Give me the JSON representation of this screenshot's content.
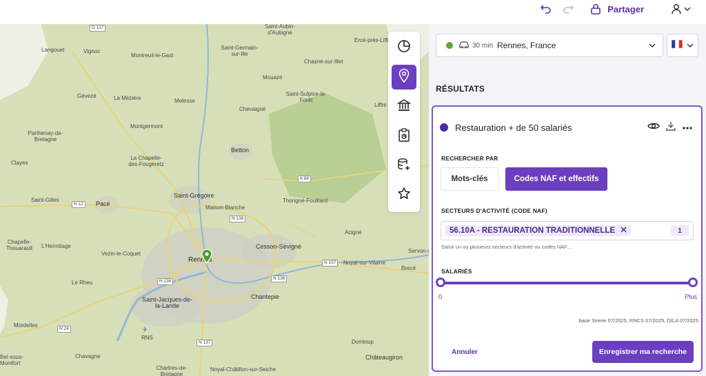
{
  "topbar": {
    "share_label": "Partager",
    "icons": [
      "undo-icon",
      "redo-icon",
      "lock-icon",
      "user-icon",
      "chevron-down-icon"
    ]
  },
  "map": {
    "places": [
      {
        "name": "Langouet",
        "cls": ""
      },
      {
        "name": "Vignoc",
        "cls": ""
      },
      {
        "name": "Montreuil-le-Gast",
        "cls": ""
      },
      {
        "name": "Saint-Germain-sur-Ille",
        "cls": ""
      },
      {
        "name": "Saint-Aubin-d'Aubigné",
        "cls": ""
      },
      {
        "name": "Chasné-sur-Illet",
        "cls": ""
      },
      {
        "name": "Ercé-près-Liffré",
        "cls": ""
      },
      {
        "name": "Gévezé",
        "cls": ""
      },
      {
        "name": "La Mézière",
        "cls": ""
      },
      {
        "name": "Melesse",
        "cls": ""
      },
      {
        "name": "Mouazé",
        "cls": ""
      },
      {
        "name": "Saint-Sulpice-la-Forêt",
        "cls": ""
      },
      {
        "name": "Chevaigné",
        "cls": ""
      },
      {
        "name": "Liffré",
        "cls": ""
      },
      {
        "name": "Parthenay-de-Bretagne",
        "cls": ""
      },
      {
        "name": "Montgermont",
        "cls": ""
      },
      {
        "name": "Betton",
        "cls": "mid"
      },
      {
        "name": "Clayes",
        "cls": ""
      },
      {
        "name": "La Chapelle-des-Fougeretz",
        "cls": ""
      },
      {
        "name": "Saint-Grégoire",
        "cls": "mid"
      },
      {
        "name": "Thorigné-Fouillard",
        "cls": ""
      },
      {
        "name": "Saint-Gilles",
        "cls": ""
      },
      {
        "name": "Pacé",
        "cls": "mid"
      },
      {
        "name": "Maison-Blanche",
        "cls": ""
      },
      {
        "name": "Acigné",
        "cls": ""
      },
      {
        "name": "Chapelle-Thouarault",
        "cls": ""
      },
      {
        "name": "L'Hermitage",
        "cls": ""
      },
      {
        "name": "Cesson-Sévigné",
        "cls": "mid"
      },
      {
        "name": "Vezin-le-Coquet",
        "cls": ""
      },
      {
        "name": "Rennes",
        "cls": "big"
      },
      {
        "name": "Servon-sur-Vilaine",
        "cls": ""
      },
      {
        "name": "Noyal-sur-Vilaine",
        "cls": ""
      },
      {
        "name": "Brecé",
        "cls": ""
      },
      {
        "name": "Le Rheu",
        "cls": ""
      },
      {
        "name": "Saint-Jacques-de-la-Lande",
        "cls": "mid"
      },
      {
        "name": "Chantepie",
        "cls": "mid"
      },
      {
        "name": "Mordelles",
        "cls": ""
      },
      {
        "name": "RNS",
        "cls": ""
      },
      {
        "name": "Domloup",
        "cls": ""
      },
      {
        "name": "Chavagne",
        "cls": ""
      },
      {
        "name": "Châteaugiron",
        "cls": "mid"
      },
      {
        "name": "Noyal-Châtillon-sur-Seiche",
        "cls": ""
      },
      {
        "name": "Chartres-de-Bretagne",
        "cls": ""
      },
      {
        "name": "Bel-sous-Montfort",
        "cls": ""
      }
    ],
    "roads": [
      "D 137",
      "A 84",
      "N 12",
      "N 136",
      "N 136",
      "N 157",
      "N 136",
      "N 24",
      "N 137"
    ]
  },
  "toolbar": {
    "items": [
      {
        "name": "chart-pie-icon",
        "active": false
      },
      {
        "name": "location-pin-icon",
        "active": true
      },
      {
        "name": "bank-icon",
        "active": false
      },
      {
        "name": "clipboard-icon",
        "active": false
      },
      {
        "name": "database-add-icon",
        "active": false
      },
      {
        "name": "star-icon",
        "active": false
      }
    ]
  },
  "panel": {
    "location": {
      "duration": "30 min",
      "city": "Rennes, France",
      "status_color": "#5fa33a"
    },
    "results_title": "RÉSULTATS",
    "card": {
      "title": "Restauration + de 50 salariés",
      "search_by_label": "RECHERCHER PAR",
      "option_keywords": "Mots-clés",
      "option_naf": "Codes NAF et effectifs",
      "sector_label": "SECTEURS D'ACTIVITÉ (CODE NAF)",
      "naf_chip": "56.10A - RESTAURATION TRADITIONNELLE",
      "naf_count": "1",
      "naf_hint": "Saisir un ou plusieurs secteurs d'activité ou codes NAF...",
      "employees_label": "SALARIÉS",
      "slider_min": "0",
      "slider_max": "Plus",
      "sources": "base Sirene 07/2025, RNCS 07/2025, DILA 07/2025",
      "cancel_label": "Annuler",
      "save_label": "Enregistrer ma recherche"
    }
  },
  "colors": {
    "accent": "#6b3fc0",
    "map_land": "#d7dfb9",
    "forest": "#b7cf8f",
    "water": "#8fb8d8",
    "urban": "#cfcfc4"
  }
}
